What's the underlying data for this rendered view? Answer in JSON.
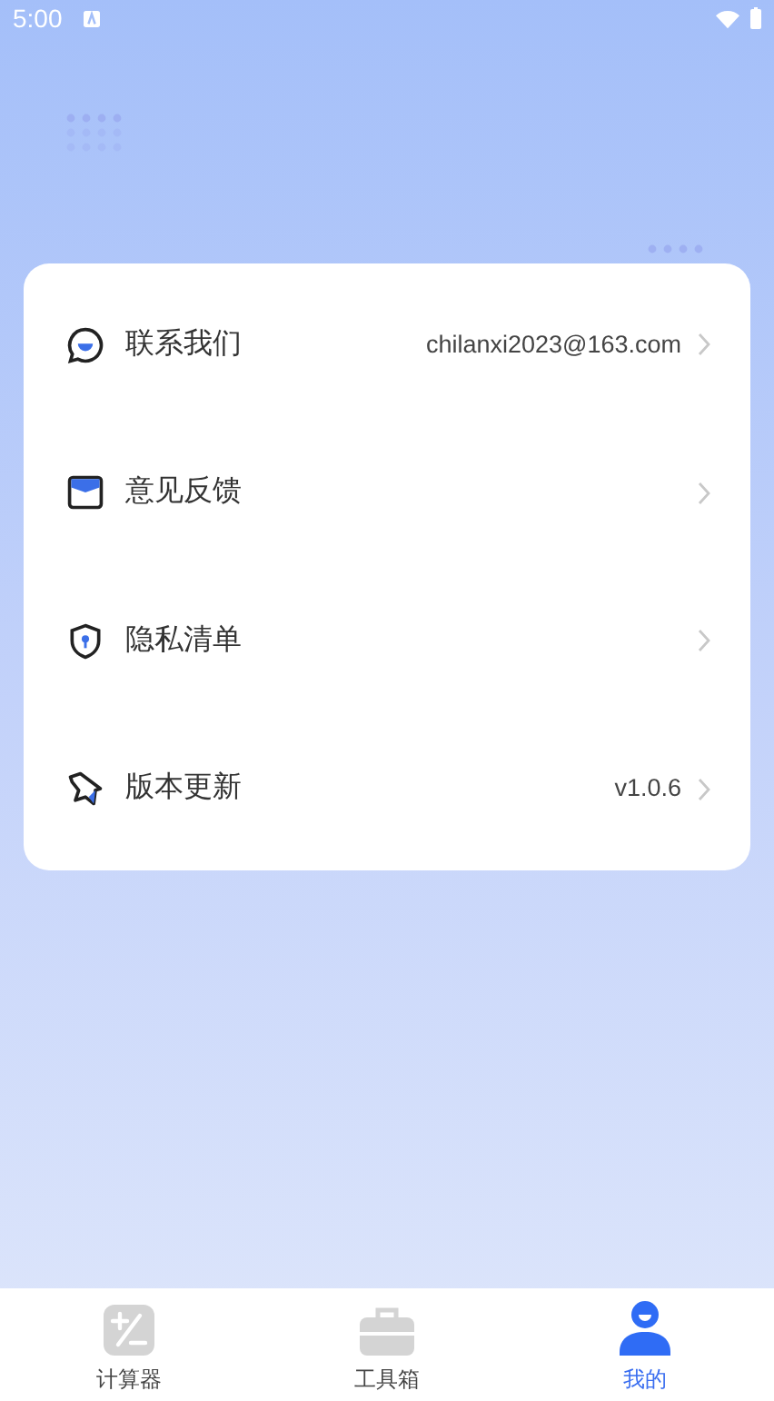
{
  "status_bar": {
    "time": "5:00"
  },
  "menu": [
    {
      "kind": "chat",
      "label": "联系我们",
      "value": "chilanxi2023@163.com"
    },
    {
      "kind": "mail",
      "label": "意见反馈"
    },
    {
      "kind": "shield",
      "label": "隐私清单"
    },
    {
      "kind": "rocket",
      "label": "版本更新",
      "value": "v1.0.6"
    }
  ],
  "bottom_nav": [
    {
      "kind": "calculator",
      "label": "计算器",
      "selected": false
    },
    {
      "kind": "toolbox",
      "label": "工具箱",
      "selected": false
    },
    {
      "kind": "person",
      "label": "我的",
      "selected": true
    }
  ]
}
